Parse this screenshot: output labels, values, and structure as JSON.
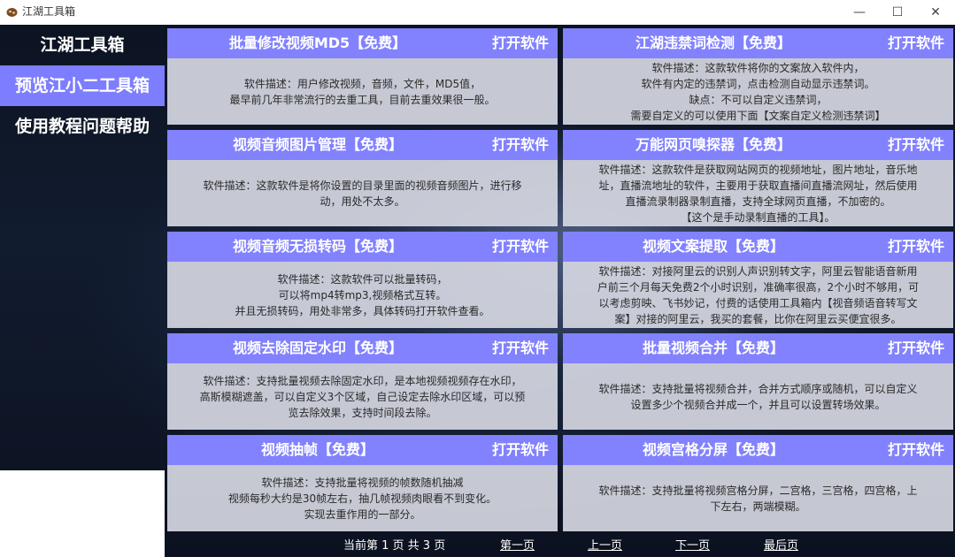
{
  "window": {
    "title": "江湖工具箱",
    "minimize_label": "—",
    "maximize_label": "☐",
    "close_label": "✕"
  },
  "sidebar": {
    "items": [
      {
        "label": "江湖工具箱",
        "active": false
      },
      {
        "label": "预览江小二工具箱",
        "active": true
      },
      {
        "label": "使用教程问题帮助",
        "active": false
      }
    ]
  },
  "open_label": "打开软件",
  "cards": [
    {
      "title": "批量修改视频MD5【免费】",
      "desc": [
        "软件描述：用户修改视频，音频，文件，MD5值，",
        "最早前几年非常流行的去重工具，目前去重效果很一般。"
      ]
    },
    {
      "title": "江湖违禁词检测【免费】",
      "desc": [
        "软件描述：这款软件将你的文案放入软件内，",
        "软件有内定的违禁词，点击检测自动显示违禁词。",
        "缺点：不可以自定义违禁词，",
        "需要自定义的可以使用下面【文案自定义检测违禁词】"
      ]
    },
    {
      "title": "视频音频图片管理【免费】",
      "desc": [
        "软件描述：这款软件是将你设置的目录里面的视频音频图片，进行移",
        "动，用处不太多。"
      ]
    },
    {
      "title": "万能网页嗅探器【免费】",
      "desc": [
        "软件描述：这款软件是获取网站网页的视频地址，图片地址，音乐地",
        "址，直播流地址的软件，主要用于获取直播间直播流网址，然后使用",
        "直播流录制器录制直播，支持全球网页直播，不加密的。",
        "【这个是手动录制直播的工具】。"
      ]
    },
    {
      "title": "视频音频无损转码【免费】",
      "desc": [
        "软件描述：这款软件可以批量转码，",
        "可以将mp4转mp3,视频格式互转。",
        "并且无损转码，用处非常多，具体转码打开软件查看。"
      ]
    },
    {
      "title": "视频文案提取【免费】",
      "desc": [
        "软件描述：对接阿里云的识别人声识别转文字，阿里云智能语音新用",
        "户前三个月每天免费2个小时识别，准确率很高，2个小时不够用，可",
        "以考虑剪映、飞书妙记，付费的话使用工具箱内【视音频语音转写文",
        "案】对接的阿里云，我买的套餐，比你在阿里云买便宜很多。"
      ]
    },
    {
      "title": "视频去除固定水印【免费】",
      "desc": [
        "软件描述：支持批量视频去除固定水印，是本地视频视频存在水印，",
        "高斯模糊遮盖，可以自定义3个区域，自己设定去除水印区域，可以预",
        "览去除效果，支持时间段去除。"
      ]
    },
    {
      "title": "批量视频合并【免费】",
      "desc": [
        "软件描述：支持批量将视频合并，合并方式顺序或随机，可以自定义",
        "设置多少个视频合并成一个，并且可以设置转场效果。"
      ]
    },
    {
      "title": "视频抽帧【免费】",
      "desc": [
        "软件描述：支持批量将视频的帧数随机抽减",
        "视频每秒大约是30帧左右，抽几帧视频肉眼看不到变化。",
        "实现去重作用的一部分。"
      ]
    },
    {
      "title": "视频宫格分屏【免费】",
      "desc": [
        "软件描述：支持批量将视频宫格分屏，二宫格，三宫格，四宫格，上",
        "下左右，两端模糊。"
      ]
    }
  ],
  "pager": {
    "status": "当前第 1 页 共 3 页",
    "first": "第一页",
    "prev": "上一页",
    "next": "下一页",
    "last": "最后页"
  },
  "colors": {
    "accent": "#7d7dff",
    "card_header": "#8282ff",
    "background_dark": "#0c1322"
  }
}
